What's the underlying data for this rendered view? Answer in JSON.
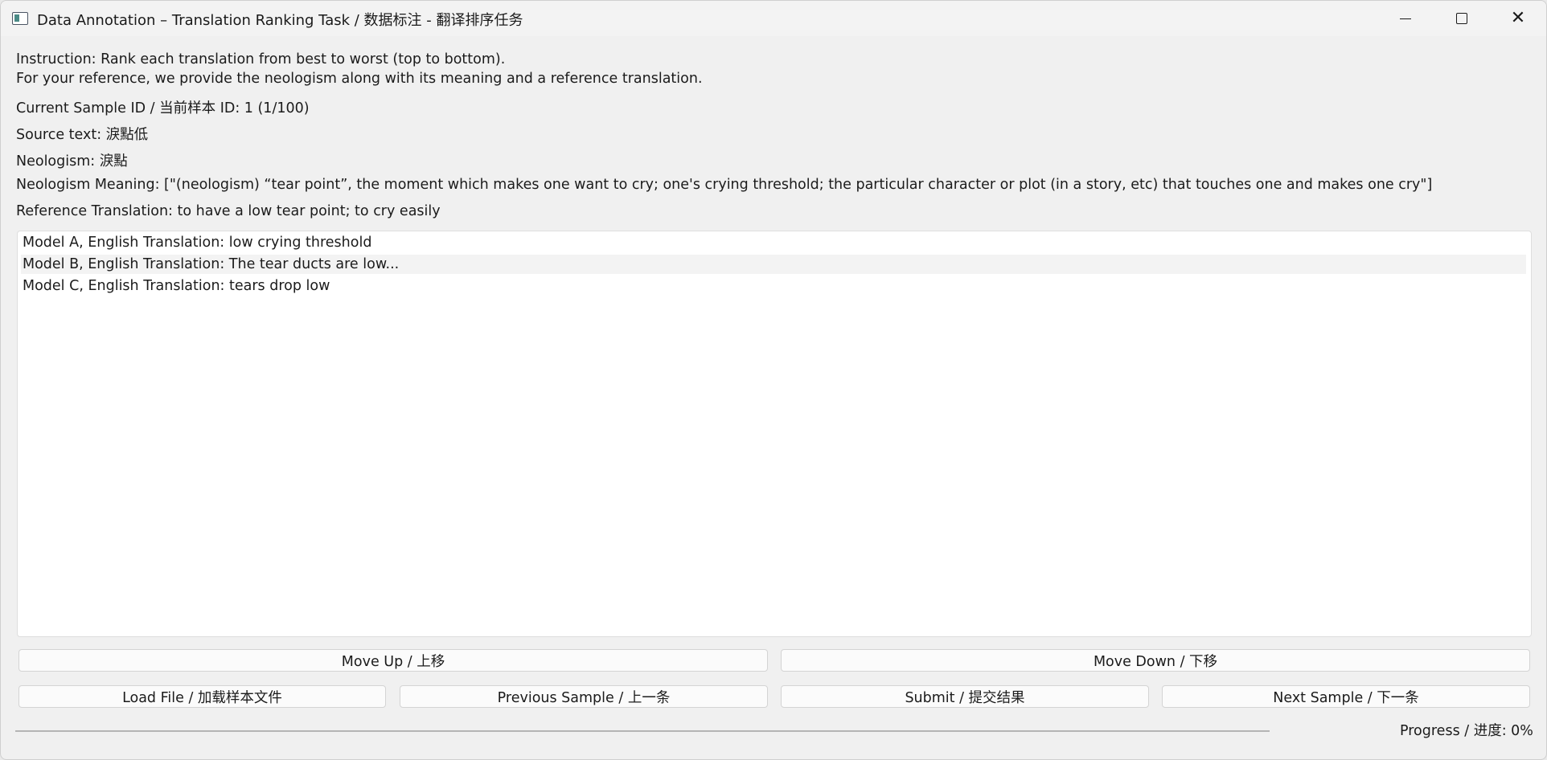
{
  "window": {
    "title": "Data Annotation – Translation Ranking Task / 数据标注 - 翻译排序任务",
    "controls": [
      "minimize-icon",
      "maximize-icon",
      "close-icon"
    ],
    "close_glyph": "✕"
  },
  "info": {
    "instruction": "Instruction: Rank each translation from best to worst (top to bottom).",
    "reference_note": "For your reference, we provide the neologism along with its meaning and a reference translation.",
    "sample_id": "Current Sample ID / 当前样本 ID: 1  (1/100)",
    "source_text": "Source text: 淚點低",
    "neologism": "Neologism: 淚點",
    "neologism_meaning": "Neologism Meaning: [\"(neologism) “tear point”, the moment which makes one want to cry; one's crying threshold; the particular character or plot (in a story, etc) that touches one and makes one cry\"]",
    "reference_translation": "Reference Translation: to have a low tear point; to cry easily"
  },
  "translations": [
    "Model A, English Translation: low crying threshold",
    "Model B, English Translation: The tear ducts are low...",
    "Model C, English Translation: tears drop low"
  ],
  "buttons": {
    "move_up": "Move Up / 上移",
    "move_down": "Move Down / 下移",
    "load_file": "Load File / 加载样本文件",
    "previous": "Previous Sample / 上一条",
    "submit": "Submit / 提交结果",
    "next": "Next Sample / 下一条"
  },
  "progress": {
    "label": "Progress / 进度: 0%",
    "value": 0
  },
  "colors": {
    "window_bg": "#f0f0f0",
    "list_bg": "#ffffff",
    "hover_row": "#f3f3f3",
    "accent": "#2a6ebd"
  }
}
